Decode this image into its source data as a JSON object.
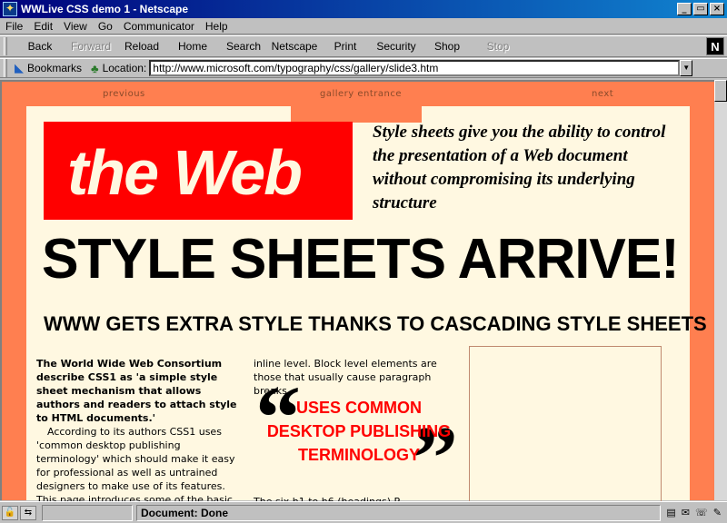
{
  "window": {
    "title": "WWLive CSS demo 1 - Netscape",
    "controls": [
      "_",
      "▭",
      "×"
    ]
  },
  "menu": [
    "File",
    "Edit",
    "View",
    "Go",
    "Communicator",
    "Help"
  ],
  "toolbar": {
    "buttons": [
      {
        "label": "Back",
        "enabled": true
      },
      {
        "label": "Forward",
        "enabled": false
      },
      {
        "label": "Reload",
        "enabled": true
      },
      {
        "label": "Home",
        "enabled": true
      },
      {
        "label": "Search",
        "enabled": true
      },
      {
        "label": "Netscape",
        "enabled": true
      },
      {
        "label": "Print",
        "enabled": true
      },
      {
        "label": "Security",
        "enabled": true
      },
      {
        "label": "Shop",
        "enabled": true
      },
      {
        "label": "Stop",
        "enabled": false
      }
    ],
    "logo": "N"
  },
  "location": {
    "bookmarks_label": "Bookmarks",
    "location_label": "Location:",
    "url": "http://www.microsoft.com/typography/css/gallery/slide3.htm"
  },
  "page": {
    "nav": {
      "previous": "previous",
      "gallery": "gallery entrance",
      "next": "next"
    },
    "logo_text": "the Web",
    "tagline": "Style sheets give you the ability to control the presentation of a Web document without compromising its underlying structure",
    "headline": "STYLE SHEETS ARRIVE!",
    "subhead": "WWW GETS EXTRA STYLE THANKS TO CASCADING STYLE SHEETS",
    "col1_lead": "The World Wide Web Consortium describe CSS1 as 'a simple style sheet mechanism that allows authors and readers to attach style to HTML documents.'",
    "col1_body": "According to its authors CSS1 uses 'common desktop publishing terminology' which should make it easy for professional as well as untrained designers to make use of its features. This page introduces some of the basic",
    "col2_body": "inline level. Block level elements are those that usually cause paragraph breaks.",
    "col2_bottom": "The six h1 to h6 (headings) P",
    "pull_quote": "USES COMMON DESKTOP PUBLISHING TERMINOLOGY",
    "quote_open": "“",
    "quote_close": "”"
  },
  "status": {
    "text": "Document: Done"
  },
  "colors": {
    "page_bg": "#ff7f50",
    "paper": "#fff8e1",
    "logo_red": "#ff0000"
  }
}
